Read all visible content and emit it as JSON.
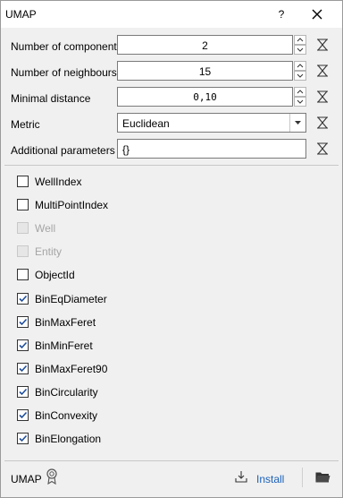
{
  "window": {
    "title": "UMAP",
    "help_label": "?"
  },
  "params": {
    "n_components": {
      "label": "Number of components",
      "value": "2"
    },
    "n_neighbours": {
      "label": "Number of neighbours",
      "value": "15"
    },
    "min_distance": {
      "label": "Minimal distance",
      "value": "0,10"
    },
    "metric": {
      "label": "Metric",
      "value": "Euclidean"
    },
    "additional": {
      "label": "Additional parameters",
      "value": "{}"
    }
  },
  "features": [
    {
      "label": "WellIndex",
      "checked": false,
      "enabled": true
    },
    {
      "label": "MultiPointIndex",
      "checked": false,
      "enabled": true
    },
    {
      "label": "Well",
      "checked": false,
      "enabled": false
    },
    {
      "label": "Entity",
      "checked": false,
      "enabled": false
    },
    {
      "label": "ObjectId",
      "checked": false,
      "enabled": true
    },
    {
      "label": "BinEqDiameter",
      "checked": true,
      "enabled": true
    },
    {
      "label": "BinMaxFeret",
      "checked": true,
      "enabled": true
    },
    {
      "label": "BinMinFeret",
      "checked": true,
      "enabled": true
    },
    {
      "label": "BinMaxFeret90",
      "checked": true,
      "enabled": true
    },
    {
      "label": "BinCircularity",
      "checked": true,
      "enabled": true
    },
    {
      "label": "BinConvexity",
      "checked": true,
      "enabled": true
    },
    {
      "label": "BinElongation",
      "checked": true,
      "enabled": true
    }
  ],
  "footer": {
    "name": "UMAP",
    "install_label": "Install"
  },
  "colors": {
    "link": "#1c61b8",
    "check": "#1f4e9c"
  }
}
